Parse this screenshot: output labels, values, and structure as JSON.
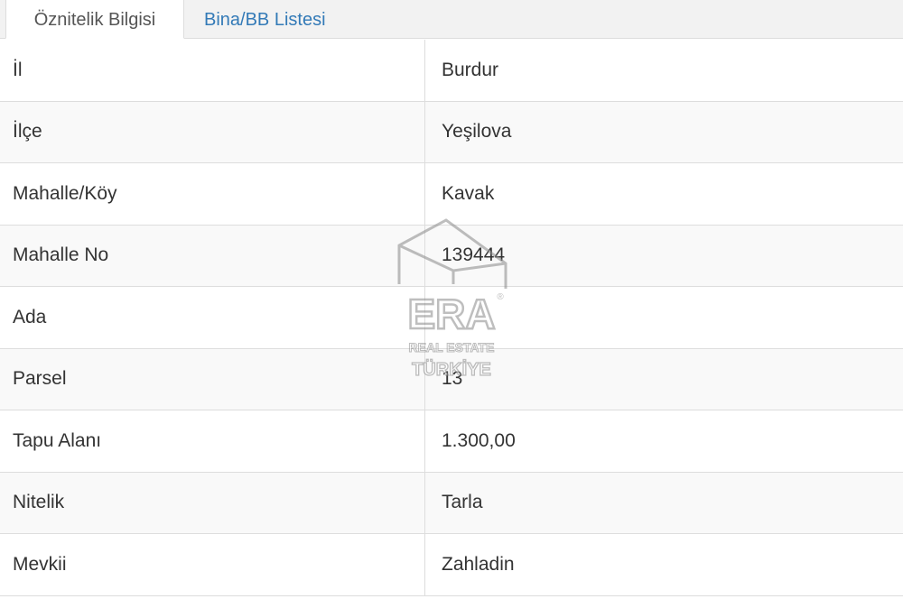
{
  "tabs": [
    {
      "label": "Öznitelik Bilgisi",
      "active": true
    },
    {
      "label": "Bina/BB Listesi",
      "active": false
    }
  ],
  "attributes": [
    {
      "label": "İl",
      "value": "Burdur"
    },
    {
      "label": "İlçe",
      "value": "Yeşilova"
    },
    {
      "label": "Mahalle/Köy",
      "value": "Kavak"
    },
    {
      "label": "Mahalle No",
      "value": "139444"
    },
    {
      "label": "Ada",
      "value": ""
    },
    {
      "label": "Parsel",
      "value": "13"
    },
    {
      "label": "Tapu Alanı",
      "value": "1.300,00"
    },
    {
      "label": "Nitelik",
      "value": "Tarla"
    },
    {
      "label": "Mevkii",
      "value": "Zahladin"
    }
  ],
  "watermark": {
    "brand": "ERA",
    "registered": "®",
    "line1": "REAL ESTATE",
    "line2": "TÜRKİYE"
  },
  "colors": {
    "link": "#337ab7",
    "border": "#dddddd",
    "stripe": "#f9f9f9",
    "tabbar": "#f2f2f2"
  }
}
